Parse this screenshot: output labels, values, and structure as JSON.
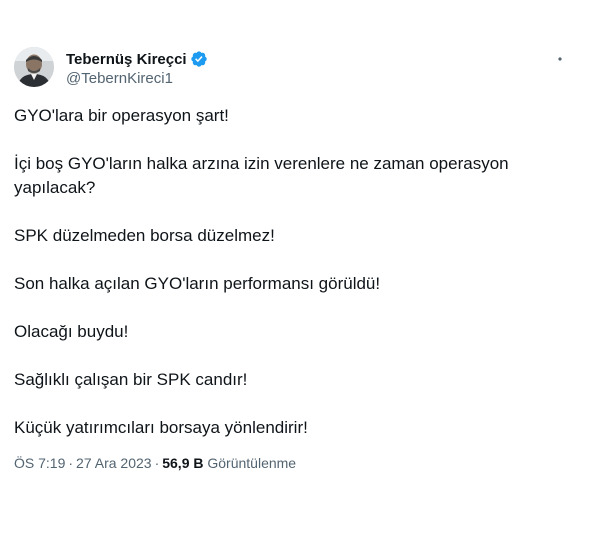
{
  "author": {
    "display_name": "Tebernüş Kireçci",
    "handle": "@TebernKireci1",
    "verified_color": "#1d9bf0"
  },
  "icons": {
    "avatar": "avatar",
    "verified": "verified-badge-icon",
    "more": "more-options-icon"
  },
  "tweet": {
    "paragraphs": [
      "GYO'lara bir operasyon şart!",
      "İçi boş GYO'ların halka arzına izin verenlere ne zaman operasyon yapılacak?",
      "SPK düzelmeden borsa düzelmez!",
      "Son halka açılan GYO'ların performansı görüldü!",
      "Olacağı buydu!",
      "Sağlıklı çalışan bir SPK candır!",
      "Küçük yatırımcıları borsaya yönlendirir!"
    ],
    "time": "ÖS 7:19",
    "separator": "·",
    "date": "27 Ara 2023",
    "views_count": "56,9 B",
    "views_label": "Görüntülenme"
  }
}
